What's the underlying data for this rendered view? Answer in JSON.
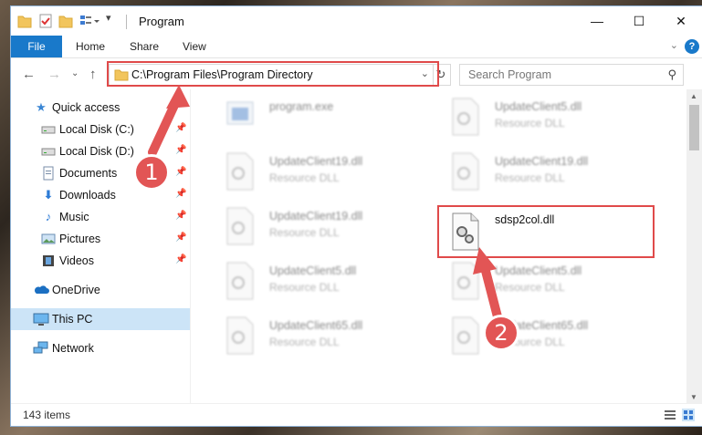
{
  "window": {
    "title": "Program",
    "controls": {
      "minimize": "—",
      "maximize": "☐",
      "close": "✕"
    }
  },
  "ribbon": {
    "tabs": [
      "File",
      "Home",
      "Share",
      "View"
    ],
    "help": "?"
  },
  "nav": {
    "address": "C:\\Program Files\\Program Directory",
    "search_placeholder": "Search Program"
  },
  "sidebar": {
    "items": [
      {
        "label": "Quick access",
        "icon": "star-icon",
        "pinned": false
      },
      {
        "label": "Local Disk (C:)",
        "icon": "drive-icon",
        "pinned": true
      },
      {
        "label": "Local Disk (D:)",
        "icon": "drive-icon",
        "pinned": true
      },
      {
        "label": "Documents",
        "icon": "documents-icon",
        "pinned": true
      },
      {
        "label": "Downloads",
        "icon": "download-icon",
        "pinned": true
      },
      {
        "label": "Music",
        "icon": "music-icon",
        "pinned": true
      },
      {
        "label": "Pictures",
        "icon": "pictures-icon",
        "pinned": true
      },
      {
        "label": "Videos",
        "icon": "videos-icon",
        "pinned": true
      },
      {
        "label": "OneDrive",
        "icon": "cloud-icon",
        "pinned": false
      },
      {
        "label": "This PC",
        "icon": "computer-icon",
        "pinned": false,
        "selected": true
      },
      {
        "label": "Network",
        "icon": "network-icon",
        "pinned": false
      }
    ]
  },
  "files": [
    {
      "name": "program.exe",
      "type": "",
      "blurred": true
    },
    {
      "name": "UpdateClient5.dll",
      "type": "Resource DLL",
      "blurred": true
    },
    {
      "name": "UpdateClient19.dll",
      "type": "Resource DLL",
      "blurred": true
    },
    {
      "name": "UpdateClient19.dll",
      "type": "Resource DLL",
      "blurred": true
    },
    {
      "name": "UpdateClient19.dll",
      "type": "Resource DLL",
      "blurred": true
    },
    {
      "name": "sdsp2col.dll",
      "type": "",
      "blurred": false
    },
    {
      "name": "UpdateClient5.dll",
      "type": "Resource DLL",
      "blurred": true
    },
    {
      "name": "UpdateClient5.dll",
      "type": "Resource DLL",
      "blurred": true
    },
    {
      "name": "UpdateClient65.dll",
      "type": "Resource DLL",
      "blurred": true
    },
    {
      "name": "UpdateClient65.dll",
      "type": "Resource DLL",
      "blurred": true
    }
  ],
  "status": {
    "item_count": "143 items"
  },
  "callouts": [
    "1",
    "2"
  ],
  "colors": {
    "accent": "#1979ca",
    "highlight": "#e04a4a",
    "selected": "#cce4f7"
  }
}
